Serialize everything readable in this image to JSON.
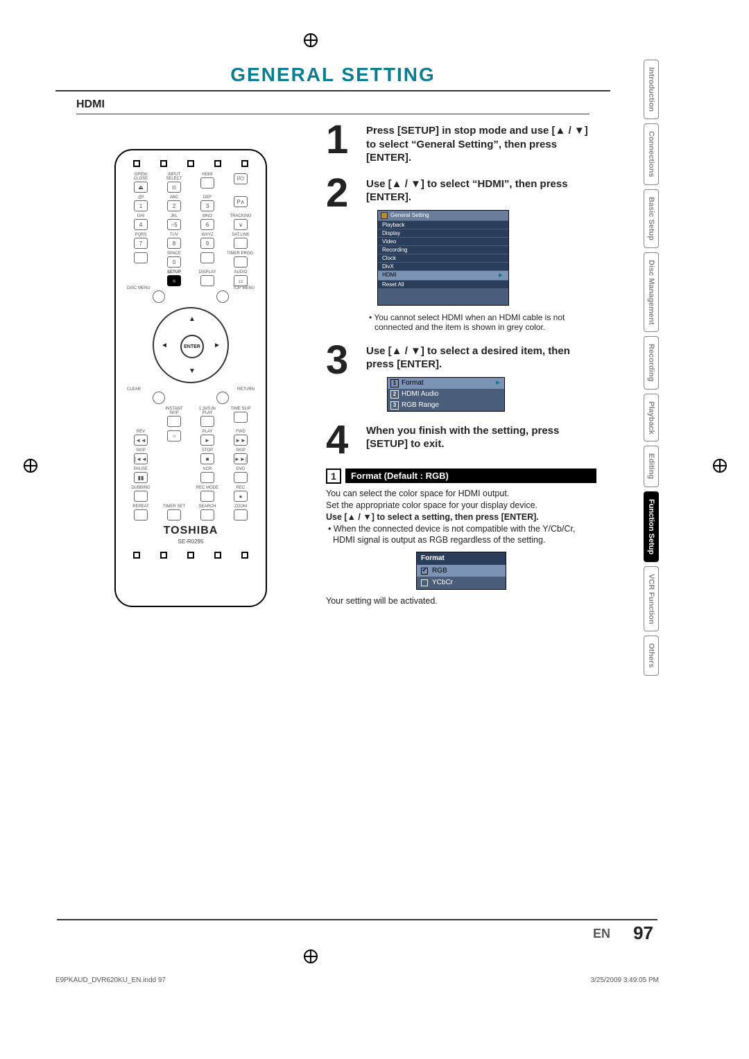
{
  "page_title": "GENERAL SETTING",
  "section": "HDMI",
  "remote": {
    "row1": [
      "OPEN/\nCLOSE",
      "INPUT\nSELECT",
      "HDMI",
      ""
    ],
    "row1_sym": [
      "⏏",
      "⊙",
      "",
      "I/⏻"
    ],
    "row2_lbl": [
      ".@/:",
      "ABC",
      "DEF",
      ""
    ],
    "row2_val": [
      "1",
      "2",
      "3",
      "P∧"
    ],
    "row3_lbl": [
      "GHI",
      "JKL",
      "MNO",
      "TRACKING"
    ],
    "row3_val": [
      "4",
      "○5",
      "6",
      "∨"
    ],
    "row4_lbl": [
      "PQRS",
      "TUV",
      "WXYZ",
      "SAT.LINK"
    ],
    "row4_val": [
      "7",
      "8",
      "9",
      ""
    ],
    "row5_lbl": [
      "",
      "SPACE",
      "",
      "TIMER\nPROG."
    ],
    "row5_val": [
      "",
      "0",
      "",
      ""
    ],
    "row6_lbl": [
      "",
      "SETUP",
      "DISPLAY",
      "AUDIO"
    ],
    "row6_val": [
      "",
      "■",
      "",
      "⚏"
    ],
    "disc_menu": "DISC MENU",
    "top_menu": "TOP MENU",
    "clear": "CLEAR",
    "ret": "RETURN",
    "enter": "ENTER",
    "row7_lbl": [
      "",
      "INSTANT\nSKIP",
      "1.3x/0.8x\nPLAY",
      "TIME SLIP"
    ],
    "row8_lbl": [
      "REV",
      "",
      "PLAY",
      "FWD"
    ],
    "row8_val": [
      "◄◄",
      "○",
      "►",
      "►►"
    ],
    "row9_lbl": [
      "SKIP",
      "",
      "STOP",
      "SKIP"
    ],
    "row9_val": [
      "|◄◄",
      "",
      "■",
      "►►|"
    ],
    "row10_lbl": [
      "PAUSE",
      "",
      "VCR",
      "DVD"
    ],
    "row10_val": [
      "▮▮",
      "",
      "",
      ""
    ],
    "row11_lbl": [
      "DUBBING",
      "",
      "REC MODE",
      "REC"
    ],
    "row11_val": [
      "",
      "",
      "",
      "●"
    ],
    "row12_lbl": [
      "REPEAT",
      "TIMER SET",
      "SEARCH",
      "ZOOM"
    ],
    "brand": "TOSHIBA",
    "model": "SE-R0295"
  },
  "steps": {
    "s1": "Press [SETUP] in stop mode and use [▲ / ▼] to select “General Setting”, then press [ENTER].",
    "s2": "Use [▲ / ▼] to select “HDMI”, then press [ENTER].",
    "s2_menu_title": "General Setting",
    "s2_menu_items": [
      "Playback",
      "Display",
      "Video",
      "Recording",
      "Clock",
      "DivX",
      "HDMI",
      "Reset All"
    ],
    "s2_note": "You cannot select HDMI when an HDMI cable is not connected and the item is shown in grey color.",
    "s3": "Use [▲ / ▼] to select a desired item, then press [ENTER].",
    "s3_items": [
      "Format",
      "HDMI Audio",
      "RGB Range"
    ],
    "s4": "When you finish with the setting, press [SETUP] to exit."
  },
  "format_section": {
    "num": "1",
    "title": "Format (Default : RGB)",
    "p1": "You can select the color space for HDMI output.",
    "p2": "Set the appropriate color space for your display device.",
    "p3": "Use [▲ / ▼] to select a setting, then press [ENTER].",
    "p4": "When the connected device is not compatible with the Y/Cb/Cr, HDMI signal is output as RGB regardless of the setting.",
    "box_title": "Format",
    "opts": [
      "RGB",
      "YCbCr"
    ],
    "p5": "Your setting will be activated."
  },
  "tabs": [
    "Introduction",
    "Connections",
    "Basic Setup",
    "Disc\nManagement",
    "Recording",
    "Playback",
    "Editing",
    "Function Setup",
    "VCR Function",
    "Others"
  ],
  "active_tab_index": 7,
  "page_footer": {
    "lang": "EN",
    "num": "97"
  },
  "print_footer": {
    "left": "E9PKAUD_DVR620KU_EN.indd   97",
    "right": "3/25/2009   3:49:05 PM"
  }
}
